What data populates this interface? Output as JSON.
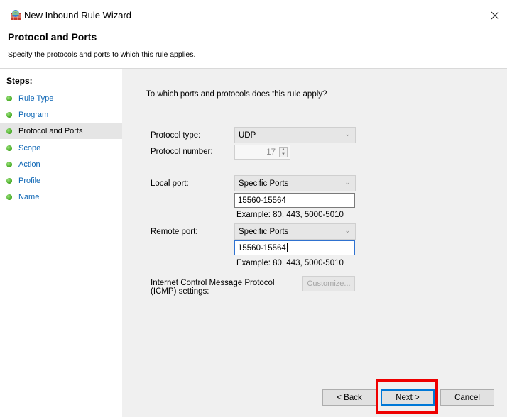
{
  "window": {
    "title": "New Inbound Rule Wizard",
    "icon": "firewall-wizard-icon",
    "close_icon": "close-icon"
  },
  "header": {
    "title": "Protocol and Ports",
    "description": "Specify the protocols and ports to which this rule applies."
  },
  "steps": {
    "heading": "Steps:",
    "items": [
      {
        "label": "Rule Type",
        "active": false
      },
      {
        "label": "Program",
        "active": false
      },
      {
        "label": "Protocol and Ports",
        "active": true
      },
      {
        "label": "Scope",
        "active": false
      },
      {
        "label": "Action",
        "active": false
      },
      {
        "label": "Profile",
        "active": false
      },
      {
        "label": "Name",
        "active": false
      }
    ]
  },
  "form": {
    "question": "To which ports and protocols does this rule apply?",
    "protocol_type_label": "Protocol type:",
    "protocol_type_value": "UDP",
    "protocol_number_label": "Protocol number:",
    "protocol_number_value": "17",
    "local_port_label": "Local port:",
    "local_port_mode": "Specific Ports",
    "local_port_value": "15560-15564",
    "local_port_example": "Example: 80, 443, 5000-5010",
    "remote_port_label": "Remote port:",
    "remote_port_mode": "Specific Ports",
    "remote_port_value": "15560-15564",
    "remote_port_example": "Example: 80, 443, 5000-5010",
    "icmp_label_line1": "Internet Control Message Protocol",
    "icmp_label_line2": "(ICMP) settings:",
    "customize_label": "Customize..."
  },
  "buttons": {
    "back": "< Back",
    "next": "Next >",
    "cancel": "Cancel"
  },
  "colors": {
    "link_blue": "#0a64b4",
    "highlight_red": "#ee0000",
    "panel_bg": "#f0f0f0",
    "focus_blue": "#0078d7"
  }
}
